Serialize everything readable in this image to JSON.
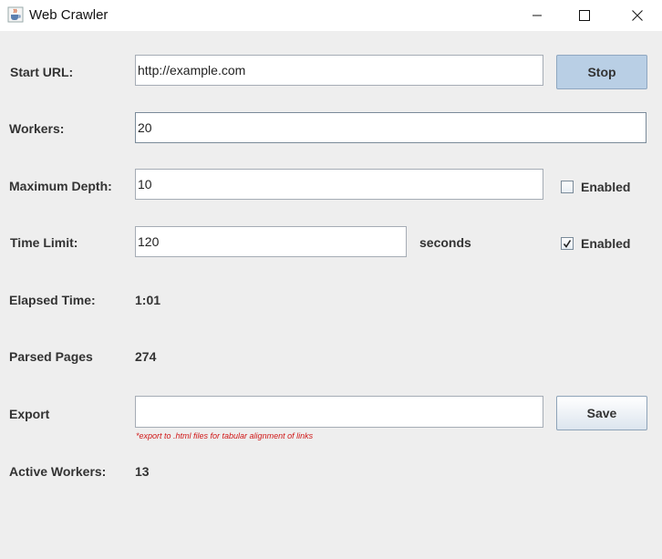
{
  "window": {
    "title": "Web Crawler",
    "icon": "java-cup-icon"
  },
  "form": {
    "start_url": {
      "label": "Start URL:",
      "value": "http://example.com"
    },
    "stop_button": "Stop",
    "workers": {
      "label": "Workers:",
      "value": "20"
    },
    "max_depth": {
      "label": "Maximum Depth:",
      "value": "10",
      "enabled_label": "Enabled",
      "enabled": false
    },
    "time_limit": {
      "label": "Time Limit:",
      "value": "120",
      "unit": "seconds",
      "enabled_label": "Enabled",
      "enabled": true
    },
    "elapsed_time": {
      "label": "Elapsed Time:",
      "value": "1:01"
    },
    "parsed_pages": {
      "label": "Parsed Pages",
      "value": "274"
    },
    "export": {
      "label": "Export",
      "value": "",
      "hint": "*export to .html files for tabular alignment of links"
    },
    "save_button": "Save",
    "active_workers": {
      "label": "Active Workers:",
      "value": "13"
    }
  },
  "colors": {
    "hint": "#d01818",
    "stop_button_bg": "#b9cfe5",
    "background": "#eeeeee"
  }
}
